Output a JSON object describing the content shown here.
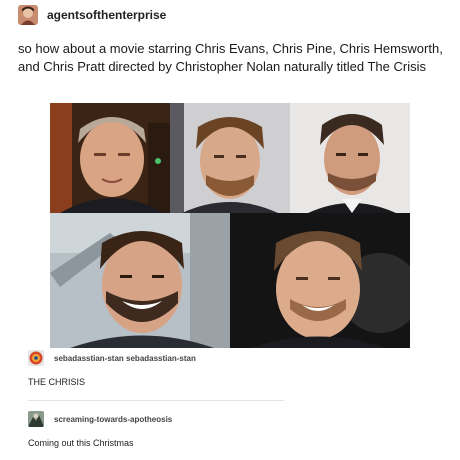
{
  "post": {
    "username": "agentsofthenterprise",
    "caption": "so how about a movie starring Chris Evans, Chris Pine, Chris Hemsworth, and Chris Pratt directed by Christopher Nolan naturally titled The Crisis"
  },
  "reblogs": [
    {
      "username": "sebadasstian-stan sebadasstian-stan",
      "text": "THE CHRISIS"
    },
    {
      "username": "screaming-towards-apotheosis",
      "text": "Coming out this Christmas"
    }
  ]
}
